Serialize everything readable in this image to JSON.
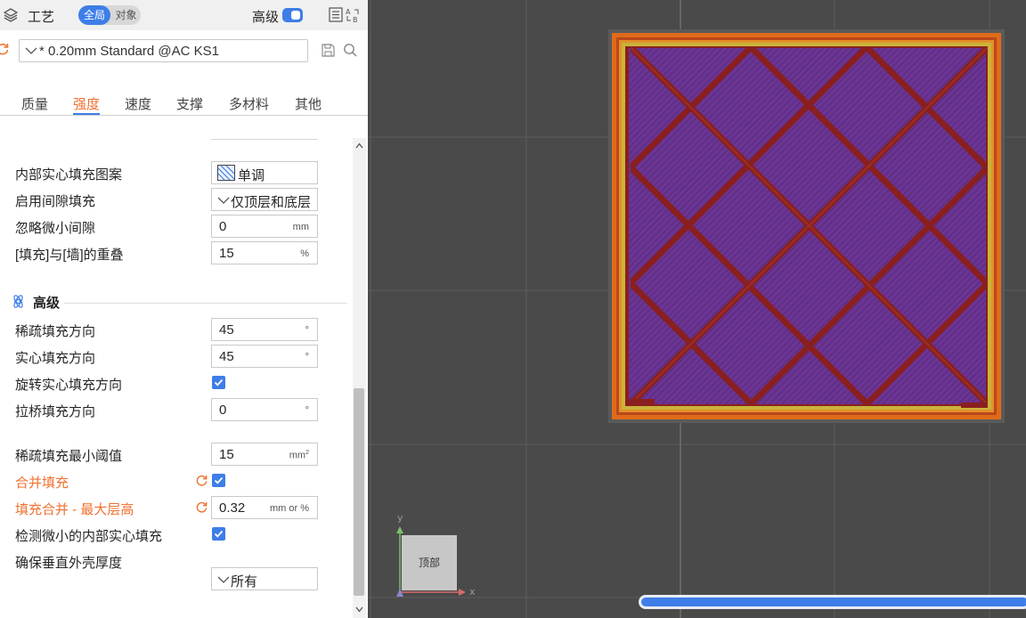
{
  "header": {
    "title": "工艺",
    "scope_global": "全局",
    "scope_object": "对象",
    "advanced_label": "高级",
    "advanced_on": true
  },
  "preset": {
    "name": "* 0.20mm Standard @AC KS1"
  },
  "tabs": [
    {
      "label": "质量",
      "active": false
    },
    {
      "label": "强度",
      "active": true
    },
    {
      "label": "速度",
      "active": false
    },
    {
      "label": "支撑",
      "active": false
    },
    {
      "label": "多材料",
      "active": false
    },
    {
      "label": "其他",
      "active": false
    }
  ],
  "settings": {
    "internal_solid_pattern": {
      "label": "内部实心填充图案",
      "value": "单调",
      "icon": "monotonic-pattern-icon"
    },
    "gap_fill": {
      "label": "启用间隙填充",
      "value": "仅顶层和底层"
    },
    "filter_small_gaps": {
      "label": "忽略微小间隙",
      "value": "0",
      "unit": "mm"
    },
    "infill_wall_overlap": {
      "label": "[填充]与[墙]的重叠",
      "value": "15",
      "unit": "%"
    }
  },
  "advanced": {
    "title": "高级",
    "sparse_infill_direction": {
      "label": "稀疏填充方向",
      "value": "45",
      "unit": "°"
    },
    "solid_infill_direction": {
      "label": "实心填充方向",
      "value": "45",
      "unit": "°"
    },
    "rotate_solid_infill": {
      "label": "旋转实心填充方向",
      "checked": true
    },
    "bridge_angle": {
      "label": "拉桥填充方向",
      "value": "0",
      "unit": "°"
    },
    "minimum_sparse_infill_threshold": {
      "label": "稀疏填充最小阈值",
      "value": "15",
      "unit": "mm",
      "unit_sup": "2"
    },
    "infill_combination": {
      "label": "合并填充",
      "checked": true,
      "modified": true
    },
    "infill_combination_max_layer_height": {
      "label": "填充合并 - 最大层高",
      "value": "0.32",
      "unit": "mm or %",
      "modified": true
    },
    "detect_narrow_internal_solid_infill": {
      "label": "检测微小的内部实心填充",
      "checked": true
    },
    "ensure_vertical_shell_thickness": {
      "label": "确保垂直外壳厚度",
      "value": "所有"
    }
  },
  "viewport": {
    "view_label": "顶部",
    "axis_x": "x",
    "axis_y": "y",
    "colors": {
      "background": "#4a4a4a",
      "infill": "#6b3494",
      "infill_lines": "#8a1f1f",
      "outer_wall": "#e06a1a",
      "inner_wall": "#c9b43a",
      "accent": "#3e7ee8",
      "modified": "#f07030"
    }
  }
}
